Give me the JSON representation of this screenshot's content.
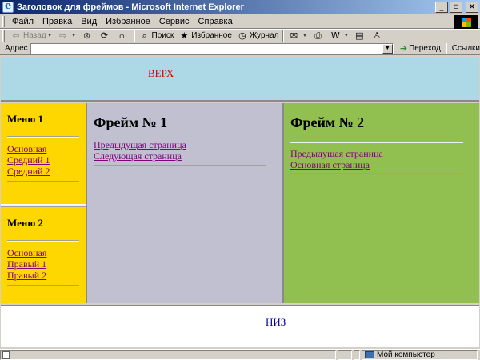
{
  "window": {
    "title": "Заголовок для фреймов - Microsoft Internet Explorer",
    "minimize": "_",
    "restore": "▫",
    "close": "×"
  },
  "menu": [
    "Файл",
    "Правка",
    "Вид",
    "Избранное",
    "Сервис",
    "Справка"
  ],
  "toolbar": {
    "back": "Назад",
    "search": "Поиск",
    "favorites": "Избранное",
    "journal": "Журнал"
  },
  "address": {
    "label": "Адрес",
    "value": "",
    "go": "Переход",
    "links": "Ссылки"
  },
  "frames": {
    "top": "ВЕРХ",
    "menu1": {
      "title": "Меню 1",
      "links": [
        "Основная",
        "Средний 1",
        "Средний 2"
      ]
    },
    "menu2": {
      "title": "Меню 2",
      "links": [
        "Основная",
        "Правый 1",
        "Правый 2"
      ]
    },
    "frame1": {
      "title": "Фрейм № 1",
      "links": [
        "Предыдущая страница",
        "Следующая страница"
      ]
    },
    "frame2": {
      "title": "Фрейм № 2",
      "links": [
        "Предыдущая страница",
        "Основная страница"
      ]
    },
    "bottom": "НИЗ"
  },
  "status": {
    "zone": "Мой компьютер"
  },
  "colors": {
    "top_frame": "#add8e6",
    "menu_frames": "#ffd700",
    "frame1": "#c0c0d0",
    "frame2": "#92c050",
    "bottom_frame": "#ffffff",
    "top_label": "#d40000",
    "bottom_label": "#00008b",
    "visited_link": "#800080"
  }
}
